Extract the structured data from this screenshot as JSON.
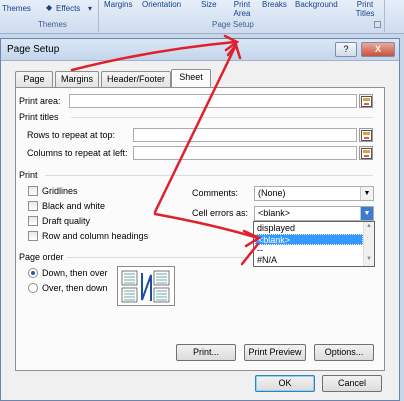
{
  "ribbon": {
    "themes_button": "Themes",
    "effects_button": "Effects",
    "themes_group": "Themes",
    "margins_button": "Margins",
    "orientation_button": "Orientation",
    "size_button": "Size",
    "print_area_button": "Print Area",
    "breaks_button": "Breaks",
    "background_button": "Background",
    "print_titles_button": "Print Titles",
    "page_setup_group": "Page Setup"
  },
  "dialog": {
    "title": "Page Setup",
    "help_label": "?",
    "close_label": "X",
    "tabs": [
      {
        "label": "Page"
      },
      {
        "label": "Margins"
      },
      {
        "label": "Header/Footer"
      },
      {
        "label": "Sheet"
      }
    ],
    "print_area_label": "Print area:",
    "print_titles_section": "Print titles",
    "rows_label": "Rows to repeat at top:",
    "columns_label": "Columns to repeat at left:",
    "print_section": "Print",
    "checkboxes": [
      {
        "label": "Gridlines"
      },
      {
        "label": "Black and white"
      },
      {
        "label": "Draft quality"
      },
      {
        "label": "Row and column headings"
      }
    ],
    "comments_label": "Comments:",
    "comments_value": "(None)",
    "cell_errors_label": "Cell errors as:",
    "cell_errors_value": "<blank>",
    "cell_errors_options": [
      "displayed",
      "<blank>",
      "--",
      "#N/A"
    ],
    "page_order_section": "Page order",
    "radios": [
      {
        "label": "Down, then over"
      },
      {
        "label": "Over, then down"
      }
    ],
    "print_button": "Print...",
    "print_preview_button": "Print Preview",
    "options_button": "Options...",
    "ok_button": "OK",
    "cancel_button": "Cancel"
  },
  "colors": {
    "arrow": "#e0202a",
    "selection": "#3399ff",
    "ribbon_text": "#15428b"
  }
}
